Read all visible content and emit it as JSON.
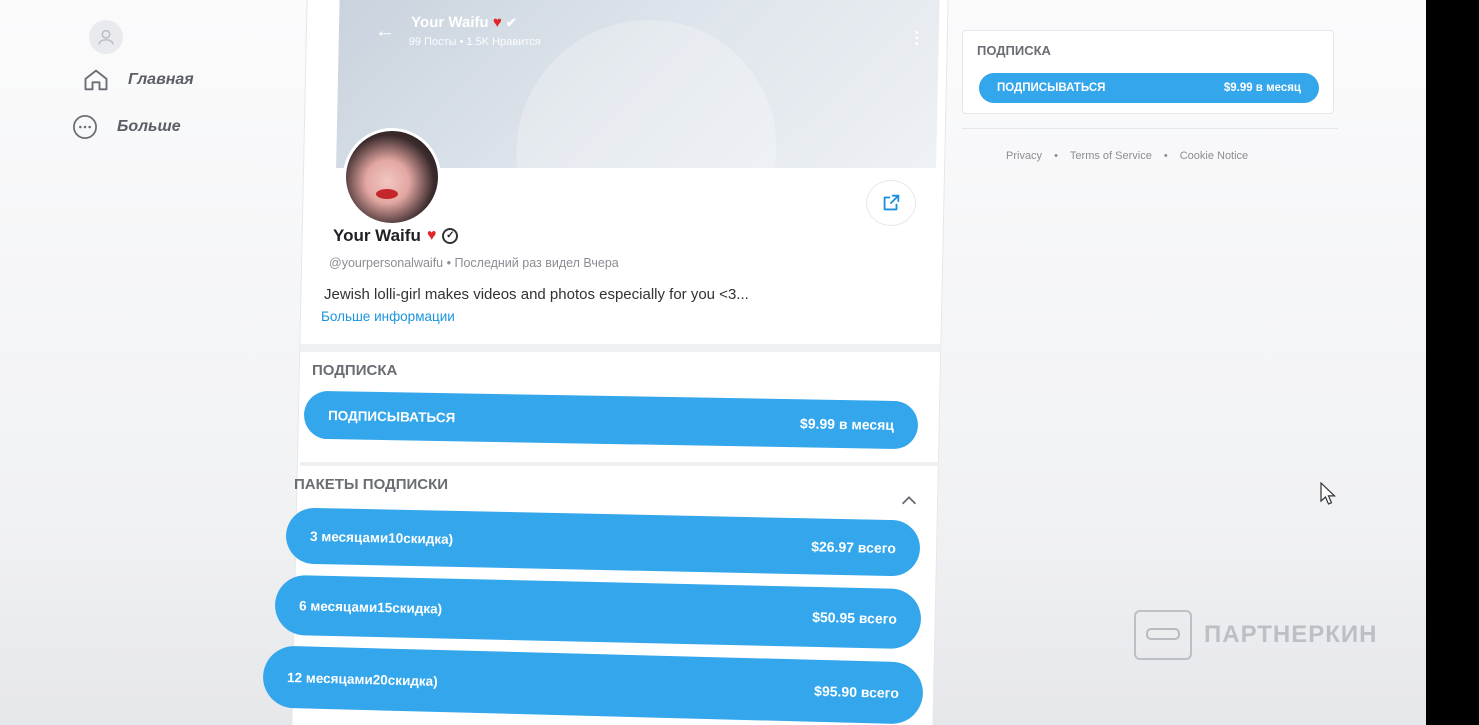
{
  "nav": {
    "home_label": "Главная",
    "more_label": "Больше"
  },
  "header": {
    "name": "Your Waifu",
    "stats": "99 Посты  •  1.5K Нравится"
  },
  "profile": {
    "name": "Your Waifu",
    "handle_line": "@yourpersonalwaifu  •  Последний раз видел Вчера",
    "bio": "Jewish lolli-girl makes videos and photos especially for you <3...",
    "more_info": "Больше информации"
  },
  "subscription": {
    "title": "ПОДПИСКА",
    "button_label": "ПОДПИСЫВАТЬСЯ",
    "price": "$9.99 в месяц"
  },
  "bundles": {
    "title": "ПАКЕТЫ ПОДПИСКИ",
    "items": [
      {
        "label": "3 месяцами10скидка)",
        "price": "$26.97 всего"
      },
      {
        "label": "6 месяцами15скидка)",
        "price": "$50.95 всего"
      },
      {
        "label": "12 месяцами20скидка)",
        "price": "$95.90 всего"
      }
    ]
  },
  "sidebar_right": {
    "title": "ПОДПИСКА",
    "button_label": "ПОДПИСЫВАТЬСЯ",
    "price": "$9.99 в месяц",
    "footer": [
      "Privacy",
      "•",
      "Terms of Service",
      "•",
      "Cookie Notice"
    ]
  },
  "watermark": {
    "text": "ПАРТНЕРКИН"
  },
  "colors": {
    "accent": "#33a6ec",
    "heart": "#e0262b"
  }
}
